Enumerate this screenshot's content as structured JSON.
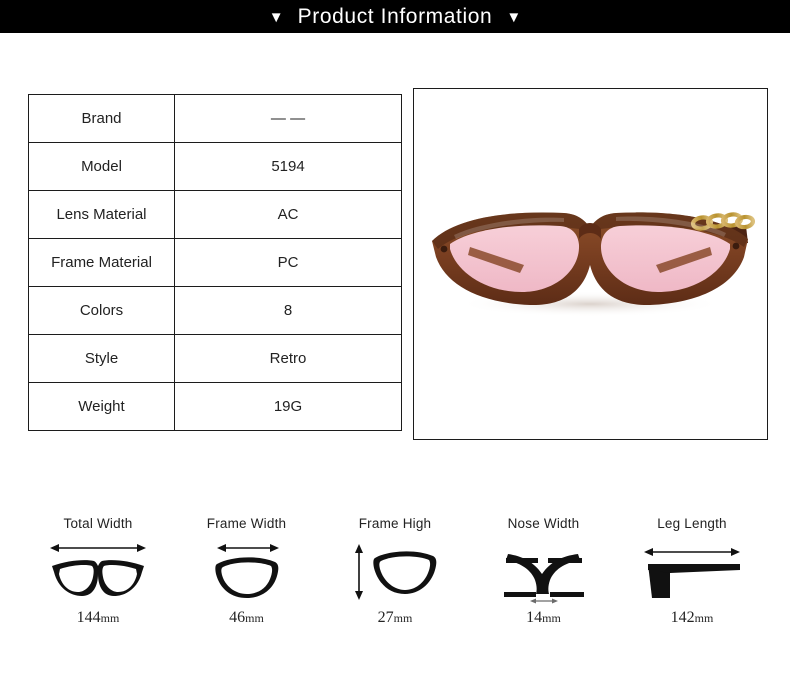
{
  "header": {
    "title": "Product Information",
    "left_caret": "▼",
    "right_caret": "▼",
    "background": "#000000",
    "text_color": "#ffffff"
  },
  "spec_table": {
    "rows": [
      {
        "label": "Brand",
        "value": "— —"
      },
      {
        "label": "Model",
        "value": "5194"
      },
      {
        "label": "Lens Material",
        "value": "AC"
      },
      {
        "label": "Frame Material",
        "value": "PC"
      },
      {
        "label": "Colors",
        "value": "8"
      },
      {
        "label": "Style",
        "value": "Retro"
      },
      {
        "label": "Weight",
        "value": "19G"
      }
    ]
  },
  "product_photo": {
    "alt": "brown cat-eye sunglasses with pink tinted lenses",
    "frame_color": "#7d4124",
    "frame_dark": "#3d1d10",
    "lens_color": "#f6c9d4",
    "chain_color": "#c9a14a",
    "background": "#ffffff"
  },
  "measurements": [
    {
      "label": "Total Width",
      "number": "144",
      "unit": "mm",
      "icon": "full-glasses-icon",
      "arrow": "horizontal"
    },
    {
      "label": "Frame Width",
      "number": "46",
      "unit": "mm",
      "icon": "single-lens-icon",
      "arrow": "horizontal"
    },
    {
      "label": "Frame High",
      "number": "27",
      "unit": "mm",
      "icon": "single-lens-icon",
      "arrow": "vertical"
    },
    {
      "label": "Nose Width",
      "number": "14",
      "unit": "mm",
      "icon": "nose-bridge-icon",
      "arrow": "horizontal-small"
    },
    {
      "label": "Leg Length",
      "number": "142",
      "unit": "mm",
      "icon": "temple-arm-icon",
      "arrow": "horizontal"
    }
  ]
}
